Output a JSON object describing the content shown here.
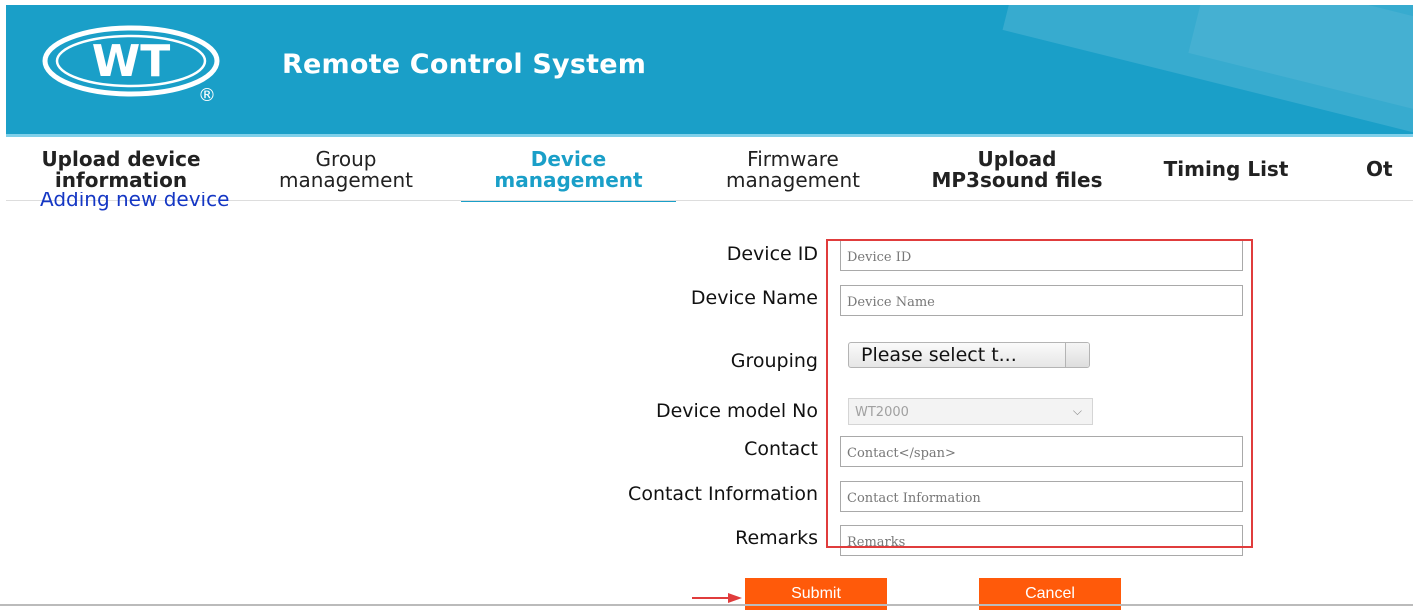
{
  "header": {
    "logo_text": "WT",
    "logo_mark": "®",
    "app_title": "Remote Control System",
    "background_color": "#1a9fc8"
  },
  "tabs": [
    {
      "line1": "Upload device",
      "line2": "information",
      "active": false
    },
    {
      "line1": "Group",
      "line2": "management",
      "active": false
    },
    {
      "line1": "Device",
      "line2": "management",
      "active": true
    },
    {
      "line1": "Firmware",
      "line2": "management",
      "active": false
    },
    {
      "line1": "Upload",
      "line2": "MP3sound files",
      "active": false
    },
    {
      "line1": "Timing List",
      "line2": "",
      "active": false
    },
    {
      "line1": "Ot",
      "line2": "",
      "active": false
    }
  ],
  "section_title": "Adding new device",
  "form": {
    "device_id": {
      "label": "Device ID",
      "placeholder": "Device ID"
    },
    "device_name": {
      "label": "Device Name",
      "placeholder": "Device Name"
    },
    "grouping": {
      "label": "Grouping",
      "selected": "Please select t..."
    },
    "model": {
      "label": "Device model No",
      "selected": "WT2000"
    },
    "contact": {
      "label": "Contact",
      "placeholder": "Contact</span>"
    },
    "contact_info": {
      "label": "Contact Information",
      "placeholder": "Contact Information"
    },
    "remarks": {
      "label": "Remarks",
      "placeholder": "Remarks"
    }
  },
  "buttons": {
    "submit": "Submit",
    "cancel": "Cancel",
    "button_color": "#ff5a0a"
  },
  "annotation": {
    "highlight_color": "#e03c3c"
  }
}
